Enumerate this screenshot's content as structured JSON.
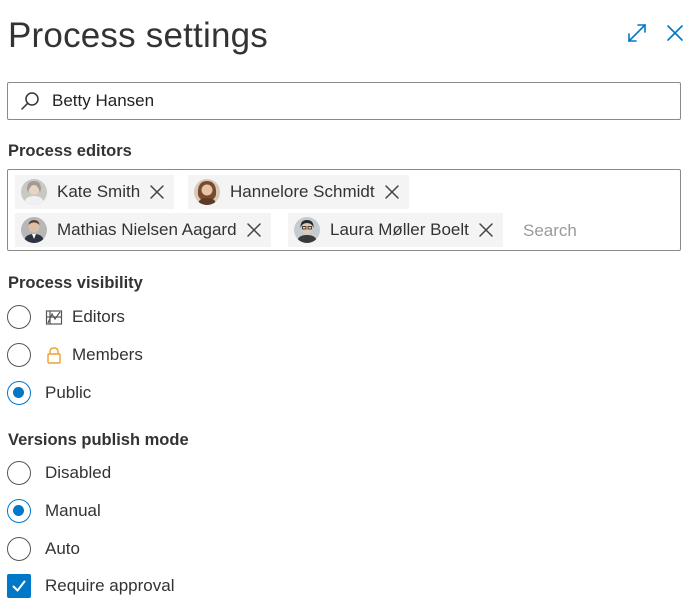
{
  "dialog": {
    "title": "Process settings",
    "expand_icon": "expand-icon",
    "close_icon": "close-icon"
  },
  "user_search": {
    "value": "Betty Hansen",
    "icon": "search-icon"
  },
  "editors": {
    "label": "Process editors",
    "chips": [
      {
        "name": "Kate Smith"
      },
      {
        "name": "Hannelore Schmidt"
      },
      {
        "name": "Mathias Nielsen Aagard"
      },
      {
        "name": "Laura Møller Boelt"
      }
    ],
    "search_placeholder": "Search"
  },
  "visibility": {
    "label": "Process visibility",
    "options": [
      {
        "label": "Editors",
        "icon": "editors-icon",
        "selected": false
      },
      {
        "label": "Members",
        "icon": "lock-icon",
        "selected": false
      },
      {
        "label": "Public",
        "selected": true
      }
    ]
  },
  "publish_mode": {
    "label": "Versions publish mode",
    "options": [
      {
        "label": "Disabled",
        "selected": false
      },
      {
        "label": "Manual",
        "selected": true
      },
      {
        "label": "Auto",
        "selected": false
      }
    ],
    "require_approval": {
      "label": "Require approval",
      "checked": true
    }
  },
  "colors": {
    "accent": "#0078c8",
    "lock": "#f0a030",
    "text": "#333333",
    "border": "#8a8a8a"
  }
}
